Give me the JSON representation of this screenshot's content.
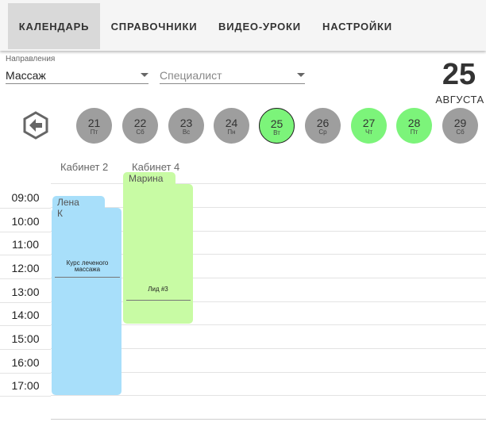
{
  "nav": {
    "tabs": [
      {
        "label": "КАЛЕНДАРЬ",
        "active": true
      },
      {
        "label": "СПРАВОЧНИКИ",
        "active": false
      },
      {
        "label": "ВИДЕО-УРОКИ",
        "active": false
      },
      {
        "label": "НАСТРОЙКИ",
        "active": false
      }
    ]
  },
  "filters": {
    "direction_label": "Направления",
    "direction_value": "Массаж",
    "specialist_placeholder": "Специалист"
  },
  "date": {
    "day": "25",
    "month": "АВГУСТА"
  },
  "days": [
    {
      "num": "21",
      "wd": "Пт",
      "state": "gray"
    },
    {
      "num": "22",
      "wd": "Сб",
      "state": "gray"
    },
    {
      "num": "23",
      "wd": "Вс",
      "state": "gray"
    },
    {
      "num": "24",
      "wd": "Пн",
      "state": "gray"
    },
    {
      "num": "25",
      "wd": "Вт",
      "state": "selected"
    },
    {
      "num": "26",
      "wd": "Ср",
      "state": "gray"
    },
    {
      "num": "27",
      "wd": "Чт",
      "state": "green"
    },
    {
      "num": "28",
      "wd": "Пт",
      "state": "green"
    },
    {
      "num": "29",
      "wd": "Сб",
      "state": "gray"
    }
  ],
  "rooms": [
    "Кабинет 2",
    "Кабинет 4"
  ],
  "times": [
    "09:00",
    "10:00",
    "11:00",
    "12:00",
    "13:00",
    "14:00",
    "15:00",
    "16:00",
    "17:00"
  ],
  "events": [
    {
      "specialist": "Лена К",
      "service": "Курс леченого массажа",
      "color": "#a8dffa"
    },
    {
      "specialist": "Марина",
      "service": "Лид #3",
      "color": "#c8fba4"
    }
  ],
  "colors": {
    "green": "#7cf47a",
    "gray": "#9e9e9e",
    "blue_event": "#a8dffa",
    "green_event": "#c8fba4"
  }
}
